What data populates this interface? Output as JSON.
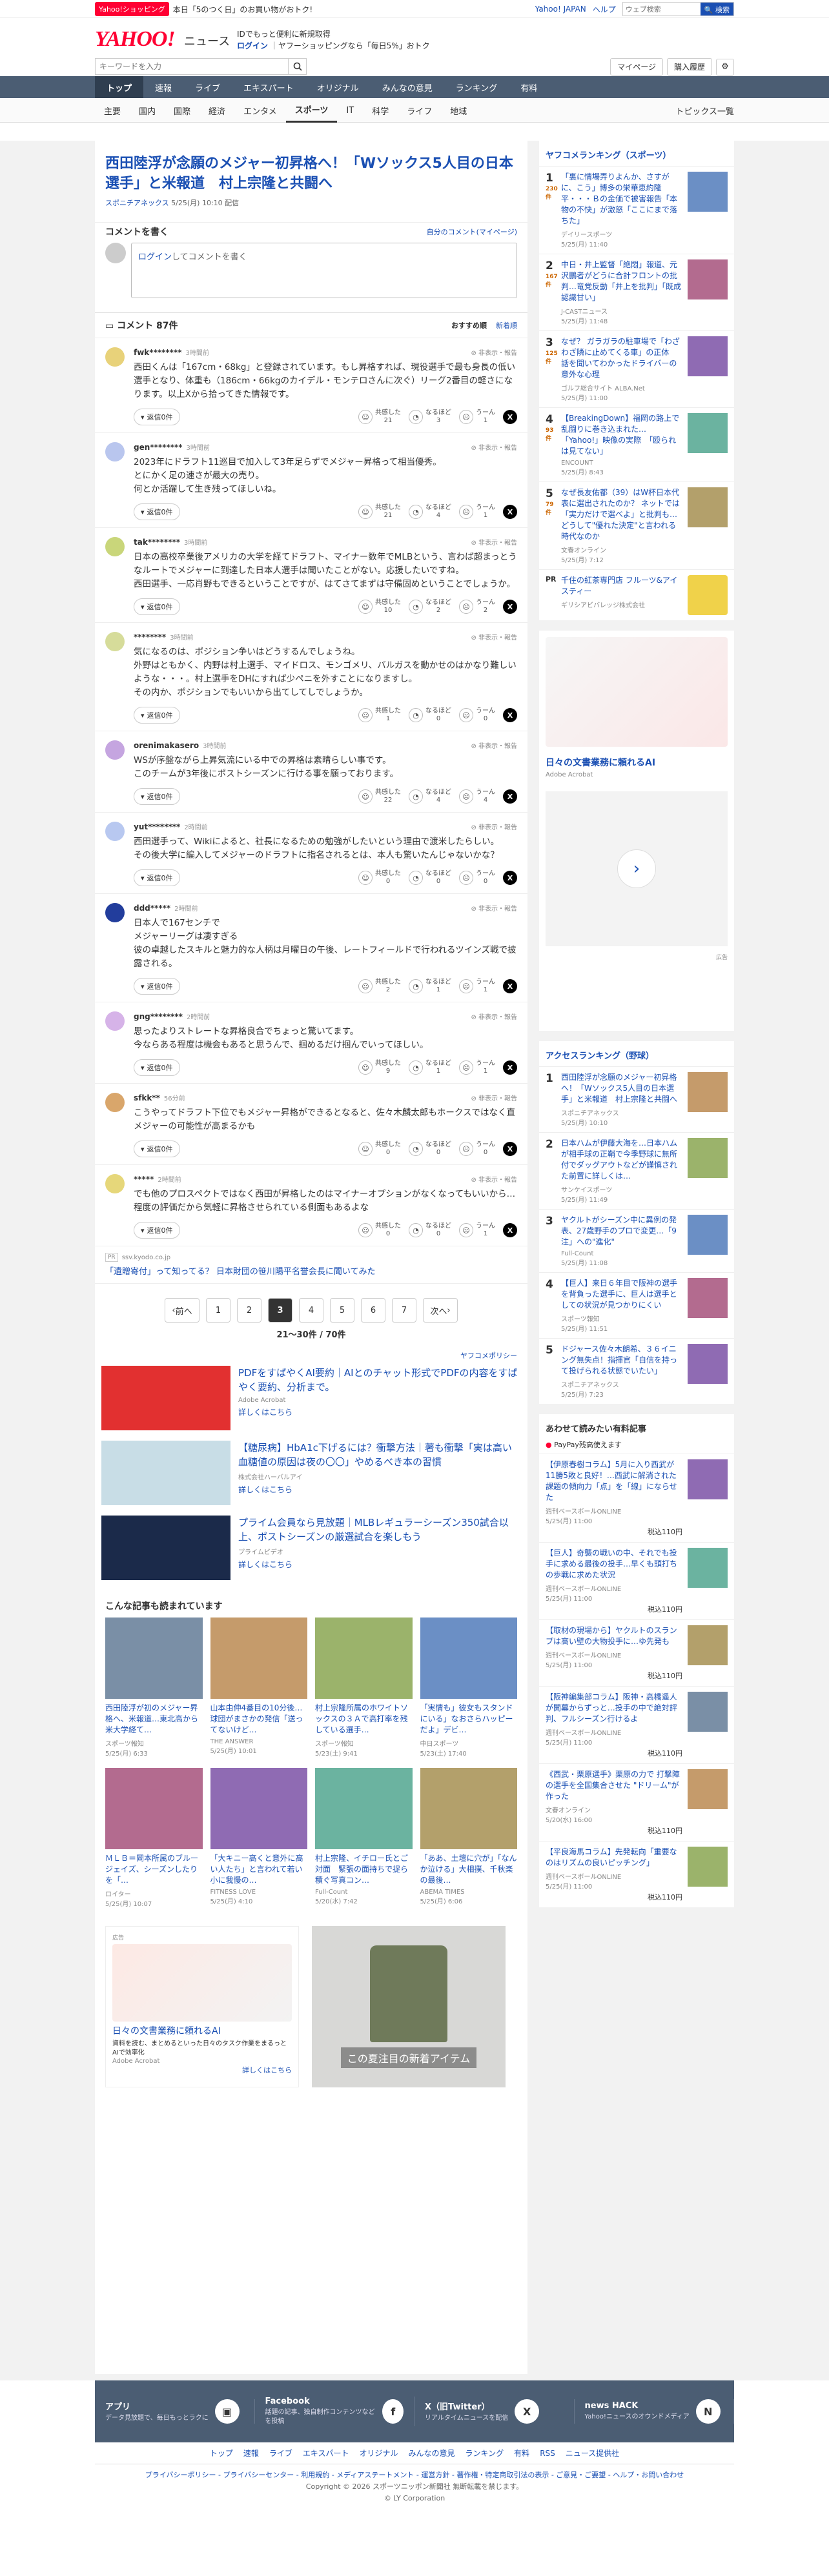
{
  "topbar": {
    "badge": "Yahoo!ショッピング",
    "promo": "本日「5のつく日」のお買い物がおトク!",
    "links": [
      "Yahoo! JAPAN",
      "ヘルプ"
    ],
    "search_placeholder": "ウェブ検索",
    "search_button": "🔍 検索"
  },
  "header": {
    "logo": "YAHOO!",
    "logo_sub": "ニュース",
    "info_line1": "IDでもっと便利に新規取得",
    "login": "ログイン",
    "info_line2": "ヤフーショッピングなら「毎日5%」おトク",
    "search_placeholder": "キーワードを入力",
    "mypage": "マイページ",
    "purchase": "購入履歴"
  },
  "mainnav": [
    "トップ",
    "速報",
    "ライブ",
    "エキスパート",
    "オリジナル",
    "みんなの意見",
    "ランキング",
    "有料"
  ],
  "subnav": [
    "主要",
    "国内",
    "国際",
    "経済",
    "エンタメ",
    "スポーツ",
    "IT",
    "科学",
    "ライフ",
    "地域"
  ],
  "subnav_right": "トピックス一覧",
  "article": {
    "title": "西田陸浮が念願のメジャー初昇格へ！「Wソックス5人目の日本選手」と米報道　村上宗隆と共闘へ",
    "source": "スポニチアネックス",
    "date": "5/25(月) 10:10 配信"
  },
  "comment_input": {
    "section_title": "コメントを書く",
    "my_comments": "自分のコメント(マイページ)",
    "login": "ログイン",
    "placeholder": "してコメントを書く"
  },
  "comments_header": {
    "title": "コメント 87件",
    "sort_recommended": "おすすめ順",
    "sort_new": "新着順"
  },
  "comments": [
    {
      "user": "fwk********",
      "time": "3時間前",
      "text": "西田くんは「167cm・68kg」と登録されています。もし昇格すれば、現役選手で最も身長の低い選手となり、体重も（186cm・66kgのカイデル・モンテロさんに次ぐ）リーグ2番目の軽さになります。以上Xから拾ってきた情報です。",
      "agree": "21",
      "fine": "3",
      "hmm": "1",
      "color": "#e8d27a"
    },
    {
      "user": "gen********",
      "time": "3時間前",
      "text": "2023年にドラフト11巡目で加入して3年足らずでメジャー昇格って相当優秀。\nとにかく足の速さが最大の売り。\n何とか活躍して生き残ってほしいね。",
      "agree": "21",
      "fine": "4",
      "hmm": "1",
      "color": "#b9c6ee"
    },
    {
      "user": "tak********",
      "time": "3時間前",
      "text": "日本の高校卒業後アメリカの大学を経てドラフト、マイナー数年でMLBという、言わば超まっとうなルートでメジャーに到達した日本人選手は聞いたことがない。応援したいですね。\n西田選手、一応肖野もできるということですが、はてさてまずは守備固めということでしょうか。",
      "agree": "10",
      "fine": "2",
      "hmm": "2",
      "color": "#c9d67a"
    },
    {
      "user": "********",
      "time": "3時間前",
      "text": "気になるのは、ポジション争いはどうするんでしょうね。\n外野はともかく、内野は村上選手、マイドロス、モンゴメリ、バルガスを動かせのはかなり難しいような・・・。村上選手をDHにすれば少ペニを外すことになりますし。\nその内か、ポジションでもいいから出てしてしでしょうか。",
      "agree": "1",
      "fine": "0",
      "hmm": "0",
      "color": "#d6dc9a"
    },
    {
      "user": "orenimakasero",
      "time": "3時間前",
      "text": "WSが序盤ながら上昇気流にいる中での昇格は素晴らしい事です。\nこのチームが3年後にポストシーズンに行ける事を願っております。",
      "agree": "22",
      "fine": "4",
      "hmm": "4",
      "color": "#c5a5e0"
    },
    {
      "user": "yut********",
      "time": "2時間前",
      "text": "西田選手って、Wikiによると、社長になるための勉強がしたいという理由で渡米したらしい。\nその後大学に編入してメジャーのドラフトに指名されるとは、本人も驚いたんじゃないかな？",
      "agree": "0",
      "fine": "0",
      "hmm": "0",
      "color": "#b8c8f0"
    },
    {
      "user": "ddd*****",
      "time": "2時間前",
      "text": "日本人で167センチで\nメジャーリーグは凄すぎる\n彼の卓越したスキルと魅力的な人柄は月曜日の午後、レートフィールドで行われるツインズ戦で披露される。",
      "agree": "2",
      "fine": "1",
      "hmm": "1",
      "color": "#223d9c"
    },
    {
      "user": "gng********",
      "time": "2時間前",
      "text": "思ったよりストレートな昇格良合でちょっと驚いてます。\n今ならある程度は機会もあると思うんで、掴めるだけ掴んでいってほしい。",
      "agree": "9",
      "fine": "1",
      "hmm": "1",
      "color": "#d6b3e8"
    },
    {
      "user": "sfkk**",
      "time": "56分前",
      "text": "こうやってドラフト下位でもメジャー昇格ができるとなると、佐々木麟太郎もホークスではなく直メジャーの可能性が高まるかも",
      "agree": "0",
      "fine": "0",
      "hmm": "0",
      "color": "#d9a66b"
    },
    {
      "user": "*****",
      "time": "2時間前",
      "text": "でも他のプロスペクトではなく西田が昇格したのはマイナーオプションがなくなってもいいから…程度の評価だから気軽に昇格させられている側面もあるよな",
      "agree": "0",
      "fine": "0",
      "hmm": "1",
      "color": "#e6d77a"
    }
  ],
  "vote_labels": {
    "agree": "共感した",
    "fine": "なるほど",
    "hmm": "うーん"
  },
  "reply_label": "返信0件",
  "report_label": "非表示・報告",
  "inline_ad": {
    "source": "ssv.kyodo.co.jp",
    "text": "「遺贈寄付」って知ってる？ 日本財団の笹川陽平名誉会長に聞いてみた"
  },
  "pager": {
    "prev": "前へ",
    "next": "次へ",
    "pages": [
      "1",
      "2",
      "3",
      "4",
      "5",
      "6",
      "7"
    ],
    "current": "3",
    "count": "21〜30件 / 70件"
  },
  "ad_policy": "ヤフコメポリシー",
  "ads": [
    {
      "title": "PDFをすばやくAI要約｜AIとのチャット形式でPDFの内容をすばやく要約、分析まで。",
      "sponsor": "Adobe Acrobat",
      "more": "詳しくはこちら"
    },
    {
      "title": "【糖尿病】HbA1c下げるには？衝撃方法｜著も衝撃「実は高い血糖値の原因は夜の〇〇」やめるべき本の習慣",
      "sponsor": "株式会社ハーバルアイ",
      "more": "詳しくはこちら"
    },
    {
      "title": "プライム会員なら見放題｜MLBレギュラーシーズン350試合以上、ポストシーズンの厳選試合を楽しもう",
      "sponsor": "プライムビデオ",
      "more": "詳しくはこちら"
    }
  ],
  "reads_title": "こんな記事も読まれています",
  "reads": [
    {
      "title": "西田陸浮が初のメジャー昇格へ、米報道…東北高から米大学経て…",
      "src": "スポーツ報知",
      "date": "5/25(月) 6:33"
    },
    {
      "title": "山本由伸4番目の10分後…球団がまさかの発信「送ってないけど…",
      "src": "THE ANSWER",
      "date": "5/25(月) 10:01"
    },
    {
      "title": "村上宗隆所属のホワイトソックスの３Ａで高打率を残している選手…",
      "src": "スポーツ報知",
      "date": "5/23(土) 9:41"
    },
    {
      "title": "「実情も」彼女もスタンドにいる」なおさらハッピーだよ」デビ…",
      "src": "中日スポーツ",
      "date": "5/23(土) 17:40"
    },
    {
      "title": "ＭＬＢ＝岡本所属のブルージェイズ、シーズンしたりを「…",
      "src": "ロイター",
      "date": "5/25(月) 10:07"
    },
    {
      "title": "「大キニー高くと意外に高い人たち」と言われて若い小に我慢の…",
      "src": "FITNESS LOVE",
      "date": "5/25(月) 4:10"
    },
    {
      "title": "村上宗隆、イチロー氏とご対面　緊張の面持ちで捉ら積ぐ写真コン…",
      "src": "Full-Count",
      "date": "5/20(水) 7:42"
    },
    {
      "title": "「ああ、土壇に穴が」「なんか泣ける」大相撲、千秋楽の最後…",
      "src": "ABEMA TIMES",
      "date": "5/25(月) 6:06"
    }
  ],
  "small_ad": {
    "title": "日々の文書業務に頼れるAI",
    "desc": "資料を読む、まとめるといった日々のタスク作業をまるっとAIで効率化",
    "sponsor": "Adobe Acrobat",
    "more": "詳しくはこちら",
    "ad_label": "広告"
  },
  "shirt_ad": {
    "text": "この夏注目の新着アイテム"
  },
  "ranking": {
    "title": "ヤフコメランキング（スポーツ）",
    "items": [
      {
        "n": "1",
        "count": "230件",
        "title": "「裏に情場弄りよんか、さすがに、こう」博多の栄華恵約隆平・・・Ｂの金価で被害報告「本物の不快」が激怒「ここにまで落ちた」",
        "src": "デイリースポーツ",
        "date": "5/25(月) 11:40"
      },
      {
        "n": "2",
        "count": "167件",
        "title": "中日・井上監督「絶悶」報道、元沢鵬者がどうに合計フロントの批判…竜党反動「井上を批判」「既成認識甘い」",
        "src": "J-CASTニュース",
        "date": "5/25(月) 11:48"
      },
      {
        "n": "3",
        "count": "125件",
        "title": "なぜ？ ガラガラの駐車場で「わざわざ隣に止めてくる車」の正体　話を聞いてわかったドライバーの意外な心理",
        "src": "ゴルフ総合サイト ALBA.Net",
        "date": "5/25(月) 11:00"
      },
      {
        "n": "4",
        "count": "93件",
        "title": "【BreakingDown】福岡の路上で乱闘りに巻き込まれた…「Yahoo!」映像の実際　「殴られは見てない」",
        "src": "ENCOUNT",
        "date": "5/25(月) 8:43"
      },
      {
        "n": "5",
        "count": "79件",
        "title": "なぜ長友佑都（39）はW杯日本代表に選出されたのか？ ネットでは「実力だけで選べよ」と批判も…どうして\"優れた決定\"と言われる時代なのか",
        "src": "文春オンライン",
        "date": "5/25(月) 7:12"
      }
    ]
  },
  "rank_pr": {
    "title": "千住の紅茶専門店 フルーツ&アイスティー",
    "sponsor": "ギリシアビバレッジ株式会社"
  },
  "side_ad": {
    "title": "日々の文書業務に頼れるAI",
    "sponsor": "Adobe Acrobat",
    "ad_label": "広告"
  },
  "access_ranking": {
    "title": "アクセスランキング（野球）",
    "items": [
      {
        "n": "1",
        "title": "西田陸浮が念願のメジャー初昇格へ！「Wソックス5人目の日本選手」と米報道　村上宗隆と共闘へ",
        "src": "スポニチアネックス",
        "date": "5/25(月) 10:10"
      },
      {
        "n": "2",
        "title": "日本ハムが伊藤大海を…日本ハムが相手球の正鞘で今季野球に無所付でダッグアウトなどが謹慎された前置に詳しくは…",
        "src": "サンケイスポーツ",
        "date": "5/25(月) 11:49"
      },
      {
        "n": "3",
        "title": "ヤクルトがシーズン中に異例の発表、27歳野手のプロで変更…「9注」への\"進化\"",
        "src": "Full-Count",
        "date": "5/25(月) 11:08"
      },
      {
        "n": "4",
        "title": "【巨人】来日６年目で阪神の選手を背負った選手に、巨人は選手としての状況が見つかりにくい",
        "src": "スポーツ報知",
        "date": "5/25(月) 11:51"
      },
      {
        "n": "5",
        "title": "ドジャース佐々木朗希、３６イニング無失点！指揮官「自信を持って投げられる状態でいたい」",
        "src": "スポニチアネックス",
        "date": "5/25(月) 7:23"
      }
    ]
  },
  "shopping": {
    "title": "あわせて読みたい有料記事",
    "paypay": "PayPay残高使えます",
    "items": [
      {
        "title": "【伊原春樹コラム】5月に入り西武が11勝5敗と良好！…西武に解消された課題の傾向力「点」を「線」にならせた",
        "src": "週刊ベースボールONLINE",
        "date": "5/25(月) 11:00",
        "price": "税込110円"
      },
      {
        "title": "【巨人】奇襲の戦いの中、それでも投手に求める最後の投手…早くも頭打ちの歩戦に求めた状況",
        "src": "週刊ベースボールONLINE",
        "date": "5/25(月) 11:00",
        "price": "税込110円"
      },
      {
        "title": "【取材の現場から】ヤクルトのスランプは高い壁の大物投手に…ゆ先発も",
        "src": "週刊ベースボールONLINE",
        "date": "5/25(月) 11:00",
        "price": "税込110円"
      },
      {
        "title": "【阪神編集部コラム】阪神・高橋遥人が開幕からずっと…投手の中で絶対評判、フルシーズン行けるよ",
        "src": "週刊ベースボールONLINE",
        "date": "5/25(月) 11:00",
        "price": "税込110円"
      },
      {
        "title": "《西武・栗原選手》栗原の力で 打撃陣の選手を全国集合させた \"ドリーム\"が作った",
        "src": "文春オンライン",
        "date": "5/20(水) 16:00",
        "price": "税込110円"
      },
      {
        "title": "【平良海馬コラム】先発転向「重要なのはリズムの良いピッチング」",
        "src": "週刊ベースボールONLINE",
        "date": "5/25(月) 11:00",
        "price": "税込110円"
      }
    ]
  },
  "footer": [
    {
      "title": "アプリ",
      "desc": "データ見放題で、毎日もっとラクに"
    },
    {
      "title": "Facebook",
      "desc": "話題の記事、独自制作コンテンツなどを投稿"
    },
    {
      "title": "X（旧Twitter）",
      "desc": "リアルタイムニュースを配信"
    },
    {
      "title": "news HACK",
      "desc": "Yahoo!ニュースのオウンドメディア"
    }
  ],
  "footnav": [
    "トップ",
    "速報",
    "ライブ",
    "エキスパート",
    "オリジナル",
    "みんなの意見",
    "ランキング",
    "有料",
    "RSS",
    "ニュース提供社"
  ],
  "legal_line1": "プライバシーポリシー - プライバシーセンター - 利用規約 - メディアステートメント - 運営方針 - 著作権・特定商取引法の表示 - ご意見・ご要望 - ヘルプ・お問い合わせ",
  "legal_line2": "Copyright © 2026 スポーツニッポン新聞社 無断転載を禁じます。",
  "legal_line3": "© LY Corporation",
  "colors": {
    "brand": "#ff0033",
    "link": "#1a4fb3",
    "nav": "#4b5d73"
  }
}
